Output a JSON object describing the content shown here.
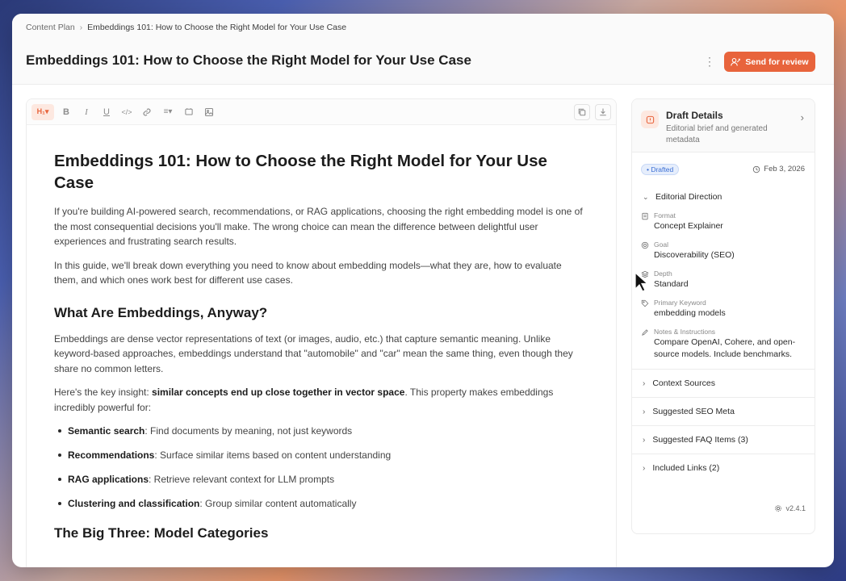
{
  "breadcrumb": {
    "parent": "Content Plan",
    "current": "Embeddings 101: How to Choose the Right Model for Your Use Case"
  },
  "header": {
    "title": "Embeddings 101: How to Choose the Right Model for Your Use Case",
    "more_label": "⋮",
    "send_label": "Send for review"
  },
  "toolbar": {
    "heading_label": "H₁▾",
    "bold": "B",
    "italic": "I",
    "underline": "U",
    "code": "</>",
    "list": "≡▾"
  },
  "doc": {
    "h1": "Embeddings 101: How to Choose the Right Model for Your Use Case",
    "p1": "If you're building AI-powered search, recommendations, or RAG applications, choosing the right embedding model is one of the most consequential decisions you'll make. The wrong choice can mean the difference between delightful user experiences and frustrating search results.",
    "p2": "In this guide, we'll break down everything you need to know about embedding models—what they are, how to evaluate them, and which ones work best for different use cases.",
    "h2a": "What Are Embeddings, Anyway?",
    "p3": "Embeddings are dense vector representations of text (or images, audio, etc.) that capture semantic meaning. Unlike keyword-based approaches, embeddings understand that \"automobile\" and \"car\" mean the same thing, even though they share no common letters.",
    "p4_start": "Here's the key insight: ",
    "p4_bold": "similar concepts end up close together in vector space",
    "p4_end": ". This property makes embeddings incredibly powerful for:",
    "bullets": [
      {
        "bold": "Semantic search",
        "rest": ": Find documents by meaning, not just keywords"
      },
      {
        "bold": "Recommendations",
        "rest": ": Surface similar items based on content understanding"
      },
      {
        "bold": "RAG applications",
        "rest": ": Retrieve relevant context for LLM prompts"
      },
      {
        "bold": "Clustering and classification",
        "rest": ": Group similar content automatically"
      }
    ],
    "h2b": "The Big Three: Model Categories"
  },
  "side": {
    "title": "Draft Details",
    "subtitle": "Editorial brief and generated metadata",
    "badge": "• Drafted",
    "date": "Feb 3, 2026",
    "section": "Editorial Direction",
    "fields": [
      {
        "label": "Format",
        "value": "Concept Explainer"
      },
      {
        "label": "Goal",
        "value": "Discoverability (SEO)"
      },
      {
        "label": "Depth",
        "value": "Standard"
      },
      {
        "label": "Primary Keyword",
        "value": "embedding models"
      },
      {
        "label": "Notes & Instructions",
        "value": "Compare OpenAI, Cohere, and open-source models. Include benchmarks."
      }
    ],
    "collapsed": [
      "Context Sources",
      "Suggested SEO Meta",
      "Suggested FAQ Items (3)",
      "Included Links (2)"
    ],
    "version": "v2.4.1"
  },
  "colors": {
    "accent": "#e8643c",
    "badge_blue": "#3b6fd4"
  },
  "icons": [
    "chevron-right-icon",
    "more-vertical-icon",
    "send-user-icon",
    "heading-icon",
    "bold-icon",
    "italic-icon",
    "underline-icon",
    "code-icon",
    "link-icon",
    "list-icon",
    "comment-icon",
    "image-icon",
    "copy-icon",
    "download-icon",
    "alert-icon",
    "calendar-icon",
    "chevron-down-icon",
    "document-icon",
    "target-icon",
    "layers-icon",
    "tag-icon",
    "pen-icon",
    "settings-icon"
  ]
}
